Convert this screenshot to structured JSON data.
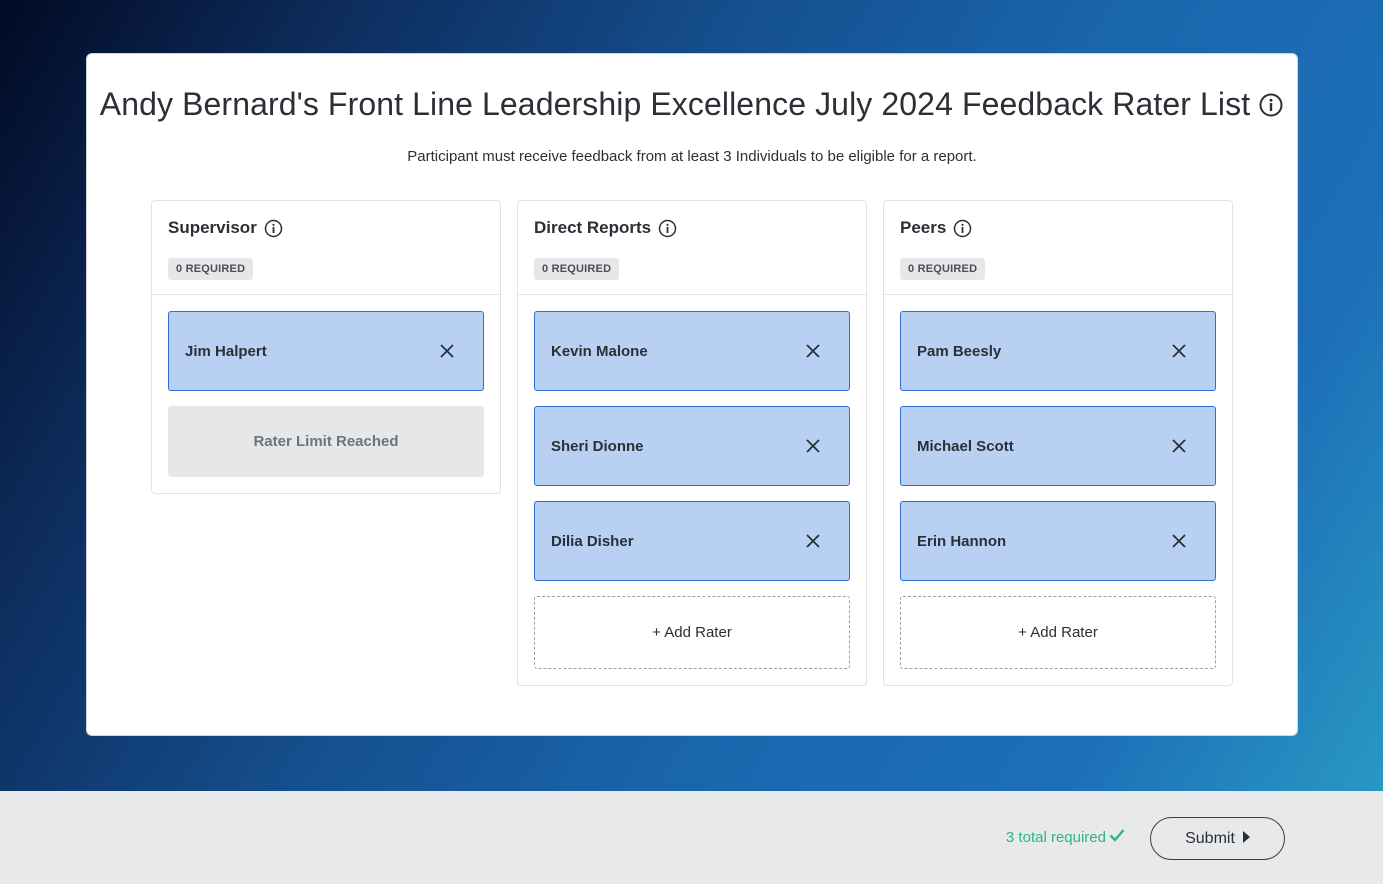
{
  "page": {
    "title": "Andy Bernard's Front Line Leadership Excellence July 2024 Feedback Rater List",
    "subtitle": "Participant must receive feedback from at least 3 Individuals to be eligible for a report."
  },
  "columns": [
    {
      "title": "Supervisor",
      "badge": "0 REQUIRED",
      "raters": [
        "Jim Halpert"
      ],
      "limit_text": "Rater Limit Reached"
    },
    {
      "title": "Direct Reports",
      "badge": "0 REQUIRED",
      "raters": [
        "Kevin Malone",
        "Sheri Dionne",
        "Dilia Disher"
      ],
      "add_label": "+ Add Rater"
    },
    {
      "title": "Peers",
      "badge": "0 REQUIRED",
      "raters": [
        "Pam Beesly",
        "Michael Scott",
        "Erin Hannon"
      ],
      "add_label": "+ Add Rater"
    }
  ],
  "footer": {
    "total_text": "3 total required",
    "submit_label": "Submit"
  },
  "colors": {
    "rater_bg": "#b8d1f3",
    "rater_border": "#2f6fcf",
    "success": "#2fb67a"
  }
}
